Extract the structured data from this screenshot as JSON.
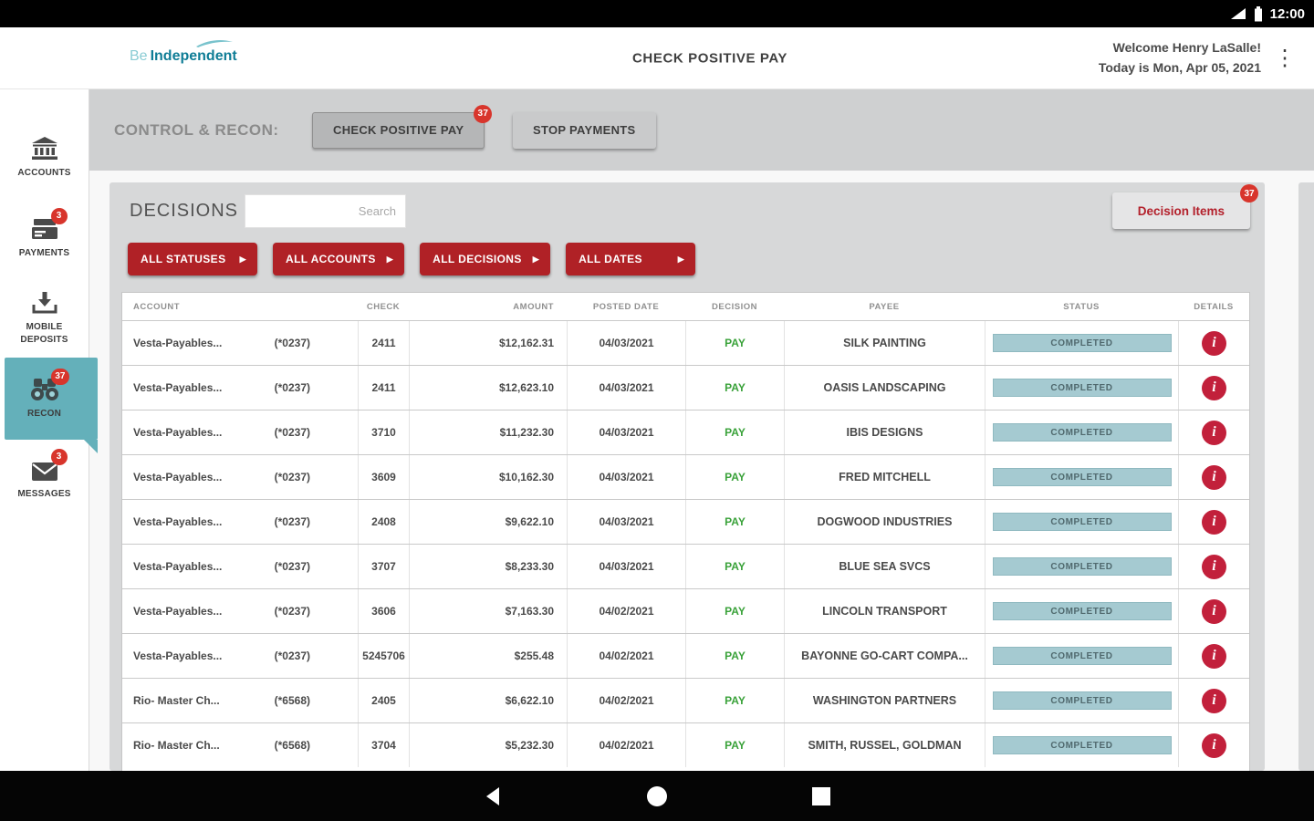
{
  "status_bar": {
    "time": "12:00"
  },
  "header": {
    "logo": {
      "prefix": "Be",
      "name": "Independent"
    },
    "title": "CHECK POSITIVE PAY",
    "welcome": "Welcome Henry LaSalle!",
    "date_line": "Today is Mon, Apr 05, 2021"
  },
  "sidebar": {
    "items": [
      {
        "label": "ACCOUNTS",
        "badge": ""
      },
      {
        "label": "PAYMENTS",
        "badge": "3"
      },
      {
        "label": "MOBILE DEPOSITS",
        "badge": ""
      },
      {
        "label": "RECON",
        "badge": "37"
      },
      {
        "label": "MESSAGES",
        "badge": "3"
      }
    ]
  },
  "control_bar": {
    "label": "CONTROL & RECON:",
    "check_positive_pay": {
      "label": "CHECK POSITIVE PAY",
      "badge": "37"
    },
    "stop_payments": {
      "label": "STOP PAYMENTS"
    }
  },
  "decisions": {
    "title": "DECISIONS",
    "search_placeholder": "Search",
    "decision_items": {
      "label": "Decision Items",
      "badge": "37"
    },
    "filters": [
      "ALL STATUSES",
      "ALL ACCOUNTS",
      "ALL DECISIONS",
      "ALL DATES"
    ],
    "table": {
      "headers": [
        "ACCOUNT",
        "CHECK",
        "AMOUNT",
        "POSTED DATE",
        "DECISION",
        "PAYEE",
        "STATUS",
        "DETAILS"
      ],
      "rows": [
        {
          "account_name": "Vesta-Payables...",
          "account_number": "(*0237)",
          "check": "2411",
          "amount": "$12,162.31",
          "posted_date": "04/03/2021",
          "decision": "PAY",
          "payee": "SILK PAINTING",
          "status": "COMPLETED"
        },
        {
          "account_name": "Vesta-Payables...",
          "account_number": "(*0237)",
          "check": "2411",
          "amount": "$12,623.10",
          "posted_date": "04/03/2021",
          "decision": "PAY",
          "payee": "OASIS LANDSCAPING",
          "status": "COMPLETED"
        },
        {
          "account_name": "Vesta-Payables...",
          "account_number": "(*0237)",
          "check": "3710",
          "amount": "$11,232.30",
          "posted_date": "04/03/2021",
          "decision": "PAY",
          "payee": "IBIS DESIGNS",
          "status": "COMPLETED"
        },
        {
          "account_name": "Vesta-Payables...",
          "account_number": "(*0237)",
          "check": "3609",
          "amount": "$10,162.30",
          "posted_date": "04/03/2021",
          "decision": "PAY",
          "payee": "FRED MITCHELL",
          "status": "COMPLETED"
        },
        {
          "account_name": "Vesta-Payables...",
          "account_number": "(*0237)",
          "check": "2408",
          "amount": "$9,622.10",
          "posted_date": "04/03/2021",
          "decision": "PAY",
          "payee": "DOGWOOD INDUSTRIES",
          "status": "COMPLETED"
        },
        {
          "account_name": "Vesta-Payables...",
          "account_number": "(*0237)",
          "check": "3707",
          "amount": "$8,233.30",
          "posted_date": "04/03/2021",
          "decision": "PAY",
          "payee": "BLUE SEA SVCS",
          "status": "COMPLETED"
        },
        {
          "account_name": "Vesta-Payables...",
          "account_number": "(*0237)",
          "check": "3606",
          "amount": "$7,163.30",
          "posted_date": "04/02/2021",
          "decision": "PAY",
          "payee": "LINCOLN TRANSPORT",
          "status": "COMPLETED"
        },
        {
          "account_name": "Vesta-Payables...",
          "account_number": "(*0237)",
          "check": "5245706",
          "amount": "$255.48",
          "posted_date": "04/02/2021",
          "decision": "PAY",
          "payee": "BAYONNE GO-CART COMPA...",
          "status": "COMPLETED"
        },
        {
          "account_name": "Rio- Master Ch...",
          "account_number": "(*6568)",
          "check": "2405",
          "amount": "$6,622.10",
          "posted_date": "04/02/2021",
          "decision": "PAY",
          "payee": "WASHINGTON PARTNERS",
          "status": "COMPLETED"
        },
        {
          "account_name": "Rio- Master Ch...",
          "account_number": "(*6568)",
          "check": "3704",
          "amount": "$5,232.30",
          "posted_date": "04/02/2021",
          "decision": "PAY",
          "payee": "SMITH, RUSSEL, GOLDMAN",
          "status": "COMPLETED"
        }
      ]
    }
  },
  "icons": {
    "chevron_right": "▶",
    "info": "i",
    "kebab": "⋮"
  }
}
